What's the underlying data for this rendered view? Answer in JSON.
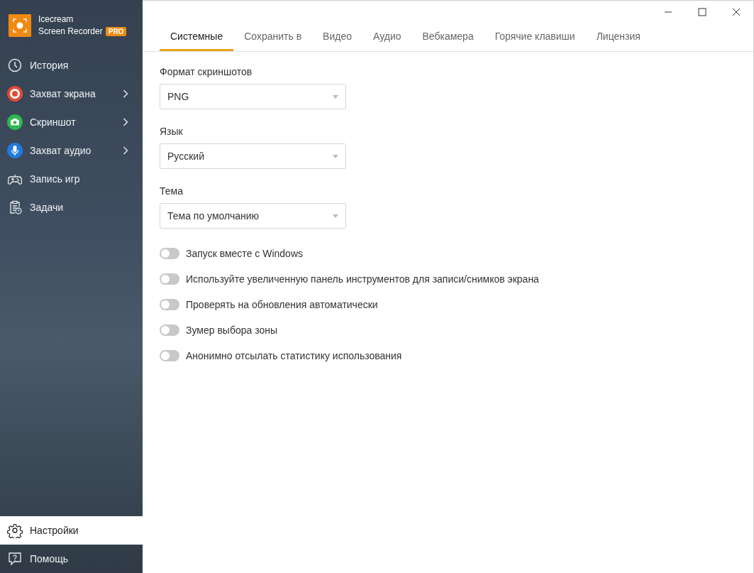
{
  "app": {
    "name_line1": "Icecream",
    "name_line2": "Screen Recorder",
    "badge": "PRO"
  },
  "sidebar": {
    "items": [
      {
        "label": "История",
        "kind": "clock",
        "submenu": false,
        "selected": false
      },
      {
        "label": "Захват экрана",
        "kind": "record",
        "submenu": true,
        "selected": false
      },
      {
        "label": "Скриншот",
        "kind": "camera",
        "submenu": true,
        "selected": false
      },
      {
        "label": "Захват аудио",
        "kind": "mic",
        "submenu": true,
        "selected": false
      },
      {
        "label": "Запись игр",
        "kind": "gamepad",
        "submenu": false,
        "selected": false
      },
      {
        "label": "Задачи",
        "kind": "tasks",
        "submenu": false,
        "selected": false
      }
    ],
    "bottom_items": [
      {
        "label": "Настройки",
        "kind": "gear",
        "selected": true
      },
      {
        "label": "Помощь",
        "kind": "help",
        "selected": false
      }
    ]
  },
  "tabs": [
    {
      "label": "Системные",
      "selected": true
    },
    {
      "label": "Сохранить в",
      "selected": false
    },
    {
      "label": "Видео",
      "selected": false
    },
    {
      "label": "Аудио",
      "selected": false
    },
    {
      "label": "Вебкамера",
      "selected": false
    },
    {
      "label": "Горячие клавиши",
      "selected": false
    },
    {
      "label": "Лицензия",
      "selected": false
    }
  ],
  "selects": [
    {
      "label": "Формат скриншотов",
      "value": "PNG"
    },
    {
      "label": "Язык",
      "value": "Русский"
    },
    {
      "label": "Тема",
      "value": "Тема по умолчанию"
    }
  ],
  "toggles": [
    {
      "label": "Запуск вместе с Windows",
      "on": false
    },
    {
      "label": "Используйте увеличенную панель инструментов для записи/снимков экрана",
      "on": false
    },
    {
      "label": "Проверять на обновления автоматически",
      "on": false
    },
    {
      "label": "Зумер выбора зоны",
      "on": false
    },
    {
      "label": "Анонимно отсылать статистику использования",
      "on": false
    }
  ]
}
